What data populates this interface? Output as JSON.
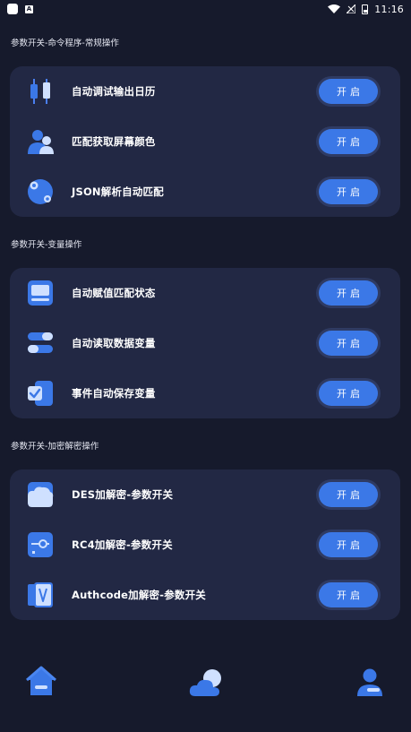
{
  "status_bar": {
    "a_badge": "A",
    "time": "11:16"
  },
  "sections": [
    {
      "title": "参数开关-命令程序-常规操作",
      "rows": [
        {
          "label": "自动调试输出日历",
          "button": "开启",
          "icon": "candlestick-icon"
        },
        {
          "label": "匹配获取屏幕颜色",
          "button": "开启",
          "icon": "users-icon"
        },
        {
          "label": "JSON解析自动匹配",
          "button": "开启",
          "icon": "disc-icon"
        }
      ]
    },
    {
      "title": "参数开关-变量操作",
      "rows": [
        {
          "label": "自动赋值匹配状态",
          "button": "开启",
          "icon": "card-icon"
        },
        {
          "label": "自动读取数据变量",
          "button": "开启",
          "icon": "toggles-icon"
        },
        {
          "label": "事件自动保存变量",
          "button": "开启",
          "icon": "checkbox-document-icon"
        }
      ]
    },
    {
      "title": "参数开关-加密解密操作",
      "rows": [
        {
          "label": "DES加解密-参数开关",
          "button": "开启",
          "icon": "cloud-card-icon"
        },
        {
          "label": "RC4加解密-参数开关",
          "button": "开启",
          "icon": "key-card-icon"
        },
        {
          "label": "Authcode加解密-参数开关",
          "button": "开启",
          "icon": "book-icon"
        }
      ]
    }
  ],
  "bottom_nav": [
    {
      "name": "home-icon"
    },
    {
      "name": "weather-icon"
    },
    {
      "name": "profile-icon"
    }
  ],
  "colors": {
    "background": "#161a2c",
    "card": "#222844",
    "accent": "#3b78e7",
    "icon_light": "#cfe0ff"
  }
}
